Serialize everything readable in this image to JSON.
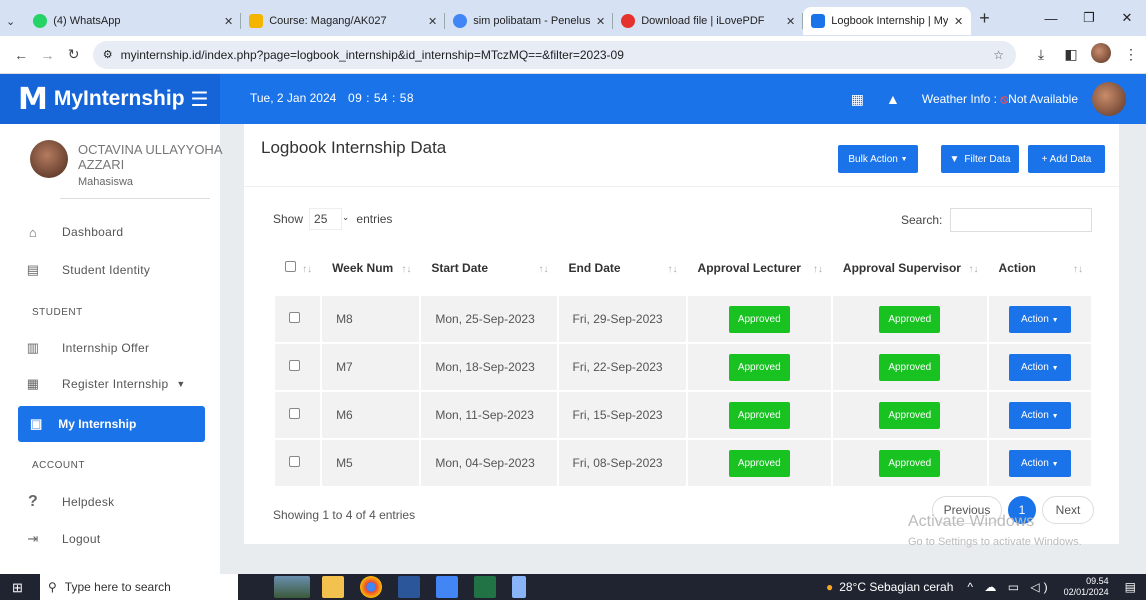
{
  "browser": {
    "tabs": [
      {
        "title": "(4) WhatsApp",
        "color": "#25d366",
        "icon": "whatsapp-icon"
      },
      {
        "title": "Course: Magang/AK027",
        "color": "#f4b400",
        "icon": "course-icon"
      },
      {
        "title": "sim polibatam - Penelusuran",
        "color": "#4285f4",
        "icon": "google-icon"
      },
      {
        "title": "Download file | iLovePDF",
        "color": "#e5322d",
        "icon": "ilovepdf-icon"
      },
      {
        "title": "Logbook Internship | MyInte",
        "color": "#1a73e8",
        "icon": "myinternship-tab-icon"
      }
    ],
    "url": "myinternship.id/index.php?page=logbook_internship&id_internship=MTczMQ==&filter=2023-09"
  },
  "app": {
    "name": "MyInternship",
    "date": "Tue, 2 Jan 2024",
    "time": "09 : 54 : 58",
    "weather_label": "Weather Info :",
    "weather_value": "Not Available"
  },
  "sidebar": {
    "user_name": "OCTAVINA ULLAYYOHA AZZARI",
    "user_role": "Mahasiswa",
    "items": {
      "dashboard": "Dashboard",
      "student_identity": "Student Identity",
      "internship_offer": "Internship Offer",
      "register_internship": "Register Internship",
      "my_internship": "My Internship",
      "helpdesk": "Helpdesk",
      "logout": "Logout"
    },
    "headers": {
      "student": "STUDENT",
      "account": "ACCOUNT"
    }
  },
  "main": {
    "title": "Logbook Internship Data",
    "buttons": {
      "bulk": "Bulk Action",
      "filter": "Filter Data",
      "add": "+ Add Data"
    },
    "show_label": "Show",
    "show_value": "25",
    "entries_label": "entries",
    "search_label": "Search:",
    "columns": [
      "Week Num",
      "Start Date",
      "End Date",
      "Approval Lecturer",
      "Approval Supervisor",
      "Action"
    ],
    "rows": [
      {
        "week": "M8",
        "start": "Mon, 25-Sep-2023",
        "end": "Fri, 29-Sep-2023",
        "lecturer": "Approved",
        "supervisor": "Approved",
        "action": "Action"
      },
      {
        "week": "M7",
        "start": "Mon, 18-Sep-2023",
        "end": "Fri, 22-Sep-2023",
        "lecturer": "Approved",
        "supervisor": "Approved",
        "action": "Action"
      },
      {
        "week": "M6",
        "start": "Mon, 11-Sep-2023",
        "end": "Fri, 15-Sep-2023",
        "lecturer": "Approved",
        "supervisor": "Approved",
        "action": "Action"
      },
      {
        "week": "M5",
        "start": "Mon, 04-Sep-2023",
        "end": "Fri, 08-Sep-2023",
        "lecturer": "Approved",
        "supervisor": "Approved",
        "action": "Action"
      }
    ],
    "info": "Showing 1 to 4 of 4 entries",
    "pager": {
      "prev": "Previous",
      "current": "1",
      "next": "Next"
    },
    "watermark_title": "Activate Windows",
    "watermark_sub": "Go to Settings to activate Windows."
  },
  "taskbar": {
    "search": "Type here to search",
    "weather": "28°C Sebagian cerah",
    "time": "09.54",
    "date": "02/01/2024"
  },
  "colors": {
    "primary": "#1a73e8",
    "approved": "#18c221"
  }
}
